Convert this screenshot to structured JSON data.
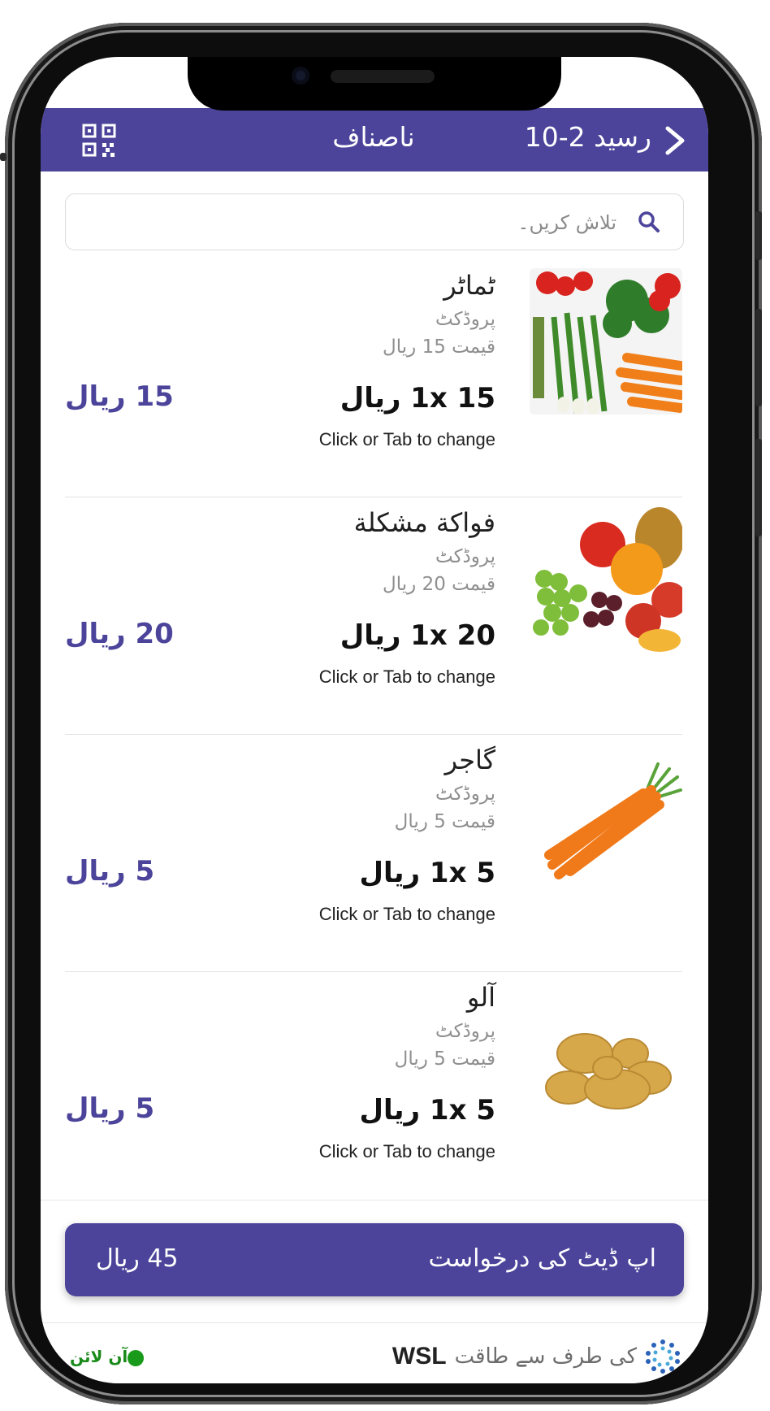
{
  "header": {
    "title": "ناصناف",
    "receipt": "رسید 2-10"
  },
  "search": {
    "placeholder": "تلاش کریں۔"
  },
  "products": [
    {
      "name": "ٹماٹر",
      "type": "پروڈکٹ",
      "price": "قیمت 15 ریال",
      "qty": "1x 15 ریال",
      "hint": "Click or Tab to change",
      "total": "15 ریال",
      "image": "mixed-vegetables-image"
    },
    {
      "name": "فواکة مشكلة",
      "type": "پروڈکٹ",
      "price": "قیمت 20 ریال",
      "qty": "1x 20 ریال",
      "hint": "Click or Tab to change",
      "total": "20 ریال",
      "image": "mixed-fruits-image"
    },
    {
      "name": "گاجر",
      "type": "پروڈکٹ",
      "price": "قیمت 5 ریال",
      "qty": "1x 5 ریال",
      "hint": "Click or Tab to change",
      "total": "5 ریال",
      "image": "carrots-image"
    },
    {
      "name": "آلو",
      "type": "پروڈکٹ",
      "price": "قیمت 5 ریال",
      "qty": "1x 5 ریال",
      "hint": "Click or Tab to change",
      "total": "5 ریال",
      "image": "potatoes-image"
    }
  ],
  "action": {
    "label": "اپ ڈیٹ کی درخواست",
    "total": "45 ریال"
  },
  "footer": {
    "powered_by": "کی طرف سے طاقت",
    "brand": "WSL",
    "status": "آن لائن"
  },
  "colors": {
    "primary": "#4b449a",
    "online": "#1a9a1a"
  }
}
